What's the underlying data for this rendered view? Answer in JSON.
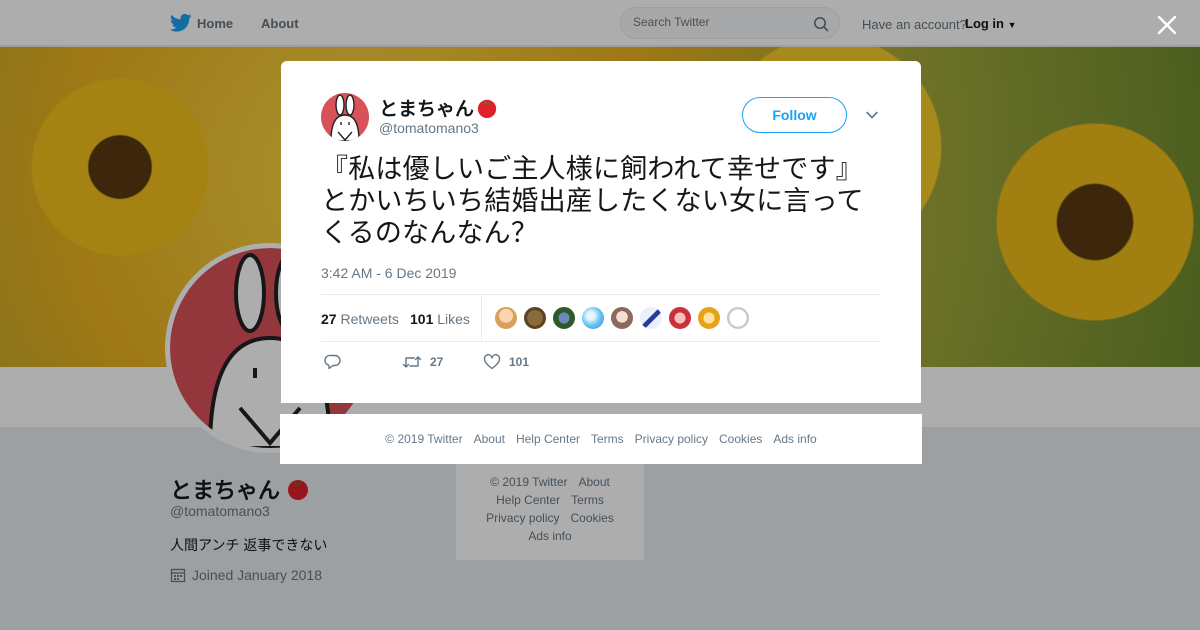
{
  "topbar": {
    "home_label": "Home",
    "about_label": "About",
    "search_placeholder": "Search Twitter",
    "account_question": "Have an account?",
    "login_label": "Log in"
  },
  "profile": {
    "name": "とまちゃん",
    "handle": "@tomatomano3",
    "bio": "人間アンチ 返事できない",
    "joined": "Joined January 2018"
  },
  "sidebar_footer": {
    "row1": [
      "© 2019 Twitter",
      "About"
    ],
    "row2": [
      "Help Center",
      "Terms"
    ],
    "row3": [
      "Privacy policy",
      "Cookies"
    ],
    "row4": [
      "Ads info"
    ]
  },
  "tweet": {
    "author_name": "とまちゃん",
    "author_handle": "@tomatomano3",
    "follow_label": "Follow",
    "text": "『私は優しいご主人様に飼われて幸せです』とかいちいち結婚出産したくない女に言ってくるのなんなん？",
    "timestamp": "3:42 AM - 6 Dec 2019",
    "retweets_count": "27",
    "retweets_label": "Retweets",
    "likes_count": "101",
    "likes_label": "Likes",
    "action_retweet_count": "27",
    "action_like_count": "101"
  },
  "modal_footer": [
    "© 2019 Twitter",
    "About",
    "Help Center",
    "Terms",
    "Privacy policy",
    "Cookies",
    "Ads info"
  ],
  "colors": {
    "twitter_blue": "#1da1f2",
    "text_primary": "#14171a",
    "text_secondary": "#657786",
    "tomato_red": "#e0202c"
  }
}
